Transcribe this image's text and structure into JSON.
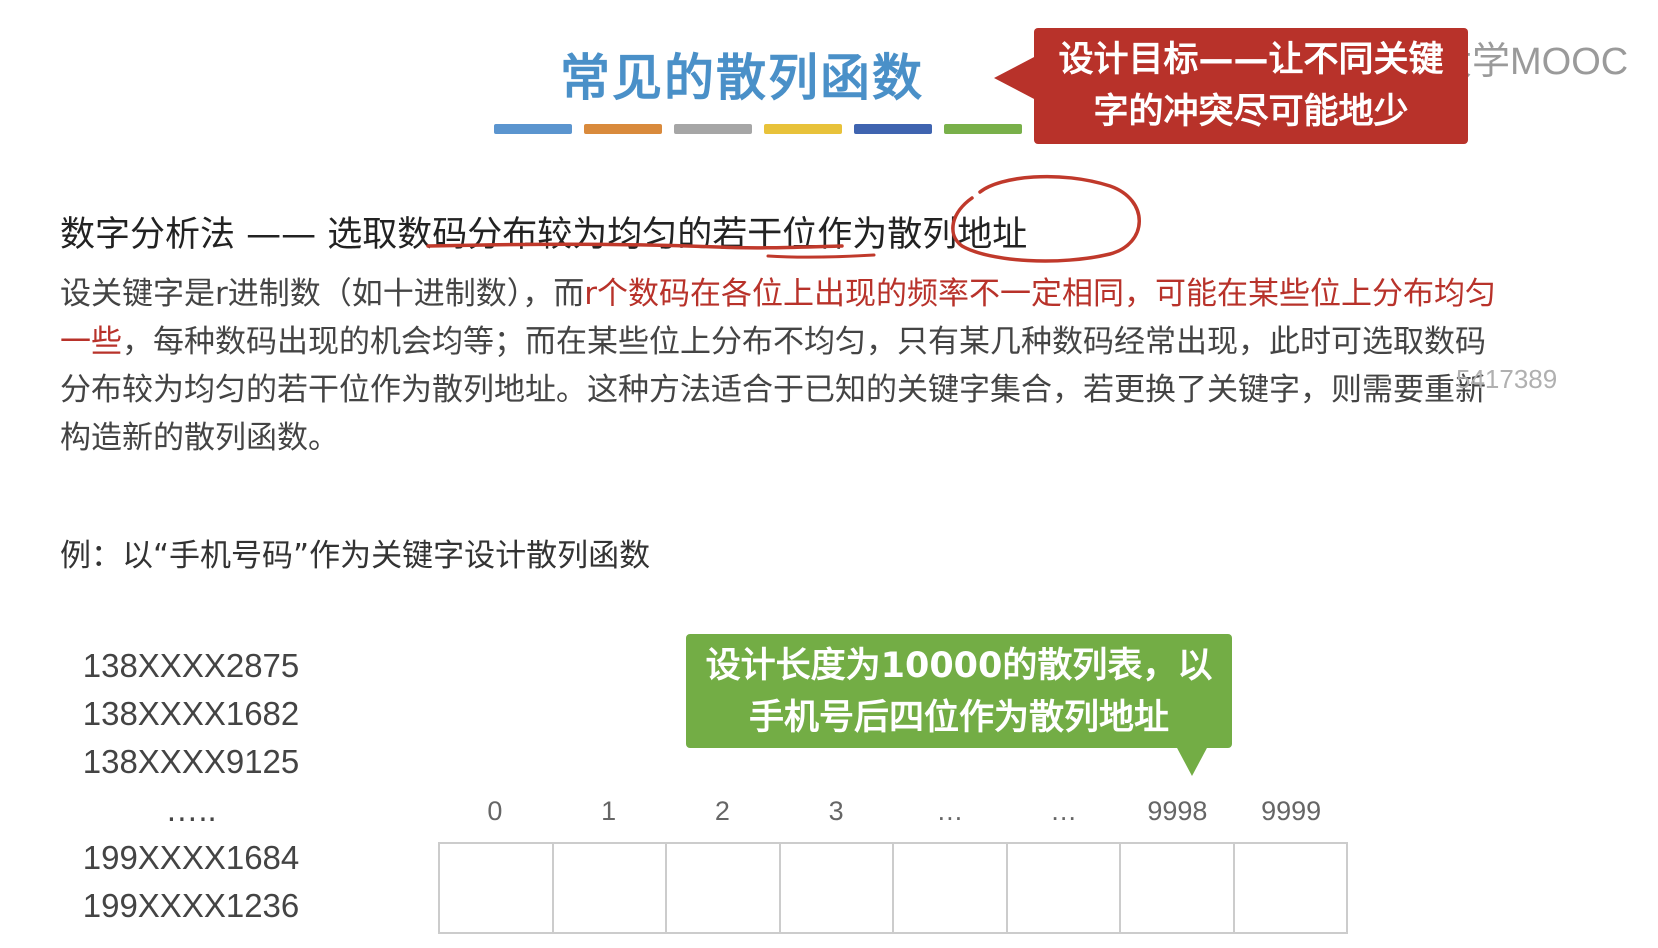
{
  "title": "常见的散列函数",
  "title_bar_colors": [
    "#5b95cf",
    "#d98a3c",
    "#a6a6a6",
    "#e8c23a",
    "#3f64b0",
    "#79b04a"
  ],
  "callout_red": {
    "line1": "设计目标——让不同关键",
    "line2": "字的冲突尽可能地少"
  },
  "watermark": "中国大学MOOC",
  "method_line": "数字分析法 —— 选取数码分布较为均匀的若干位作为散列地址",
  "paragraph": {
    "part1": "设关键字是r进制数（如十进制数），而",
    "part2_red": "r个数码在各位上出现的频率不一定相同，可能在某些位上分布均匀一些",
    "part3": "，每种数码出现的机会均等；而在某些位上分布不均匀，只有某几种数码经常出现，此时可选取数码分布较为均匀的若干位作为散列地址。这种方法适合于已知的关键字集合，若更换了关键字，则需要重新构造新的散列函数。"
  },
  "overlay_number": "5417389",
  "example_text": "例：以“手机号码”作为关键字设计散列函数",
  "phone_numbers": [
    "138XXXX2875",
    "138XXXX1682",
    "138XXXX9125",
    "…..",
    "199XXXX1684",
    "199XXXX1236"
  ],
  "callout_green": {
    "line1": "设计长度为10000的散列表，以",
    "line2": "手机号后四位作为散列地址"
  },
  "table_indices": [
    "0",
    "1",
    "2",
    "3",
    "…",
    "…",
    "9998",
    "9999"
  ],
  "colors": {
    "title": "#4a90c8",
    "callout_red": "#b8322a",
    "callout_green": "#73ad45",
    "highlight": "#b8322a"
  }
}
